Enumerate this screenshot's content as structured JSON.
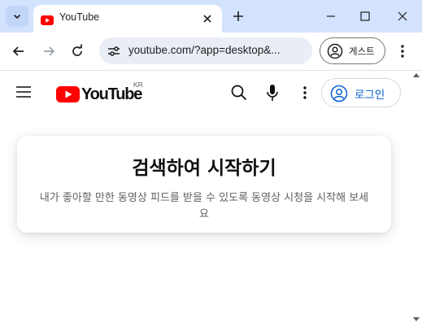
{
  "browser": {
    "tab": {
      "title": "YouTube",
      "favicon": "youtube-favicon-icon"
    },
    "address_bar": {
      "url": "youtube.com/?app=desktop&..."
    },
    "profile": {
      "label": "게스트"
    },
    "icons": {
      "tab_search": "chevron-down-icon",
      "tab_close": "close-icon",
      "new_tab": "plus-icon",
      "minimize": "minimize-icon",
      "maximize": "maximize-icon",
      "window_close": "close-icon",
      "back": "arrow-left-icon",
      "forward": "arrow-right-icon",
      "reload": "reload-icon",
      "site_info": "tune-icon",
      "menu": "vertical-dots-icon"
    },
    "colors": {
      "tabstrip": "#d3e3fd",
      "omnibox": "#e9eef6"
    }
  },
  "youtube": {
    "logo_text": "YouTube",
    "country_code": "KR",
    "signin_label": "로그인",
    "icons": {
      "menu": "hamburger-icon",
      "search": "search-icon",
      "voice": "microphone-icon",
      "more": "vertical-dots-icon",
      "account": "account-circle-icon"
    },
    "colors": {
      "brand_red": "#ff0000",
      "link_blue": "#065fd4"
    }
  },
  "prompt": {
    "title": "검색하여 시작하기",
    "body": "내가 좋아할 만한 동영상 피드를 받을 수 있도록 동영상 시청을 시작해 보세요"
  }
}
